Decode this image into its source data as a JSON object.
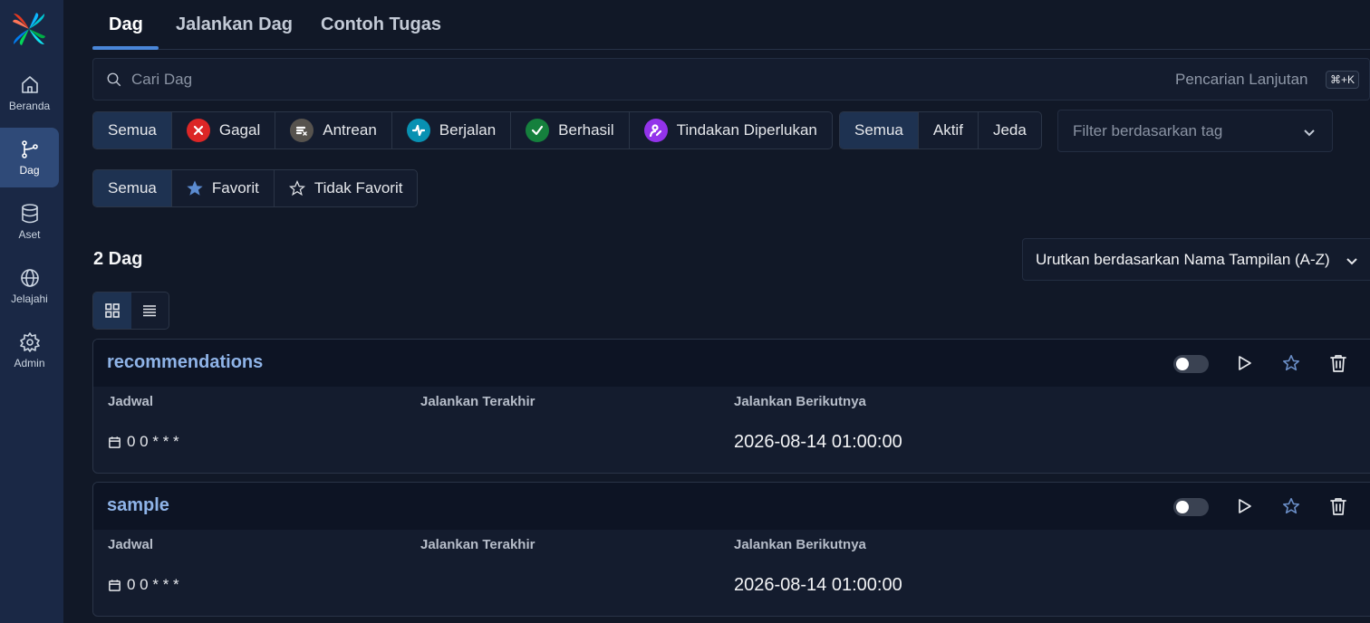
{
  "sidebar": {
    "items": [
      {
        "label": "Beranda",
        "icon": "home-icon"
      },
      {
        "label": "Dag",
        "icon": "dag-icon"
      },
      {
        "label": "Aset",
        "icon": "database-icon"
      },
      {
        "label": "Jelajahi",
        "icon": "globe-icon"
      },
      {
        "label": "Admin",
        "icon": "gear-icon"
      }
    ]
  },
  "tabs": [
    "Dag",
    "Jalankan Dag",
    "Contoh Tugas"
  ],
  "search": {
    "placeholder": "Cari Dag",
    "advanced_label": "Pencarian Lanjutan",
    "shortcut": "⌘+K"
  },
  "state_filters": [
    {
      "label": "Semua"
    },
    {
      "label": "Gagal",
      "color": "#dc2626"
    },
    {
      "label": "Antrean",
      "color": "#57534e"
    },
    {
      "label": "Berjalan",
      "color": "#0891b2"
    },
    {
      "label": "Berhasil",
      "color": "#15803d"
    },
    {
      "label": "Tindakan Diperlukan",
      "color": "#9333ea"
    }
  ],
  "active_filters": [
    "Semua",
    "Aktif",
    "Jeda"
  ],
  "tag_filter_placeholder": "Filter berdasarkan tag",
  "favorite_filters": [
    "Semua",
    "Favorit",
    "Tidak Favorit"
  ],
  "dag_count": "2 Dag",
  "sort_label": "Urutkan berdasarkan Nama Tampilan (A-Z)",
  "column_labels": {
    "schedule": "Jadwal",
    "last_run": "Jalankan Terakhir",
    "next_run": "Jalankan Berikutnya"
  },
  "dags": [
    {
      "name": "recommendations",
      "schedule": "0 0 * * *",
      "last_run": "",
      "next_run": "2026-08-14 01:00:00"
    },
    {
      "name": "sample",
      "schedule": "0 0 * * *",
      "last_run": "",
      "next_run": "2026-08-14 01:00:00"
    }
  ]
}
